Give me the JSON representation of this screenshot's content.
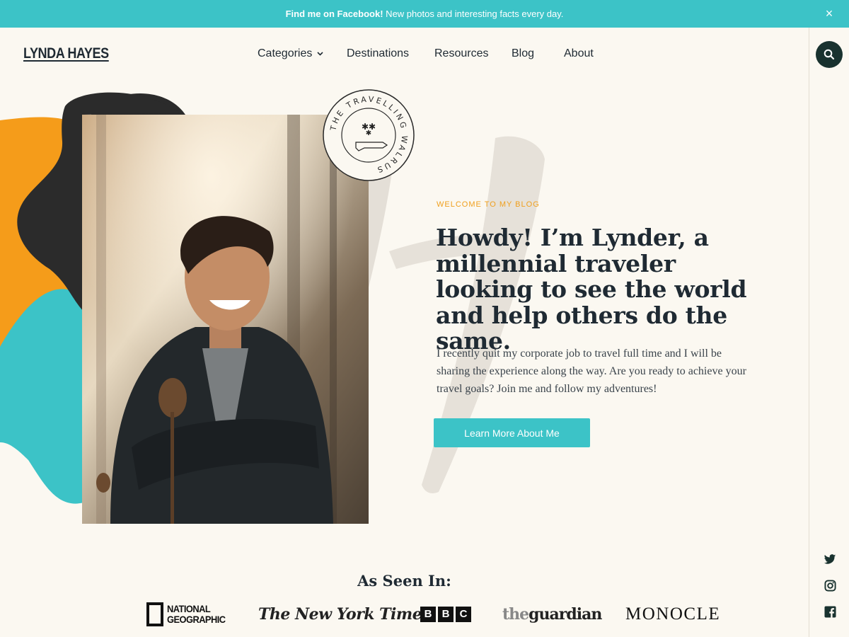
{
  "banner": {
    "link_text": "Find me on Facebook!",
    "message": " New photos and interesting facts every day.",
    "close_label": "×"
  },
  "header": {
    "logo": "LYNDA HAYES",
    "nav": [
      {
        "label": "Categories",
        "has_dropdown": true
      },
      {
        "label": "Destinations"
      },
      {
        "label": "Resources"
      },
      {
        "label": "Blog"
      },
      {
        "label": "About"
      }
    ]
  },
  "stamp": {
    "text": "THE TRAVELLING WALRUS"
  },
  "hero": {
    "eyebrow": "WELCOME TO MY BLOG",
    "headline": "Howdy! I’m Lynder, a millennial traveler looking to see the world and help others do the same.",
    "intro": "I recently quit my corporate job to travel full time and I will be sharing the experience along the way. Are you ready to achieve your travel goals?  Join me and follow my adventures!",
    "cta_label": "Learn More About Me"
  },
  "press": {
    "title": "As Seen In:",
    "logos": {
      "natgeo_line1": "NATIONAL",
      "natgeo_line2": "GEOGRAPHIC",
      "nyt": "The New York Times",
      "bbc": [
        "B",
        "B",
        "C"
      ],
      "guardian_the": "the",
      "guardian_rest": "guardian",
      "monocle": "MONOCLE"
    }
  },
  "icons": {
    "search": "search-icon",
    "twitter": "twitter-icon",
    "instagram": "instagram-icon",
    "facebook": "facebook-icon",
    "chevron": "chevron-down-icon"
  },
  "colors": {
    "accent_teal": "#3cc3c7",
    "accent_orange": "#f59c1a",
    "dark": "#1f2a33",
    "background": "#fbf8f1"
  }
}
